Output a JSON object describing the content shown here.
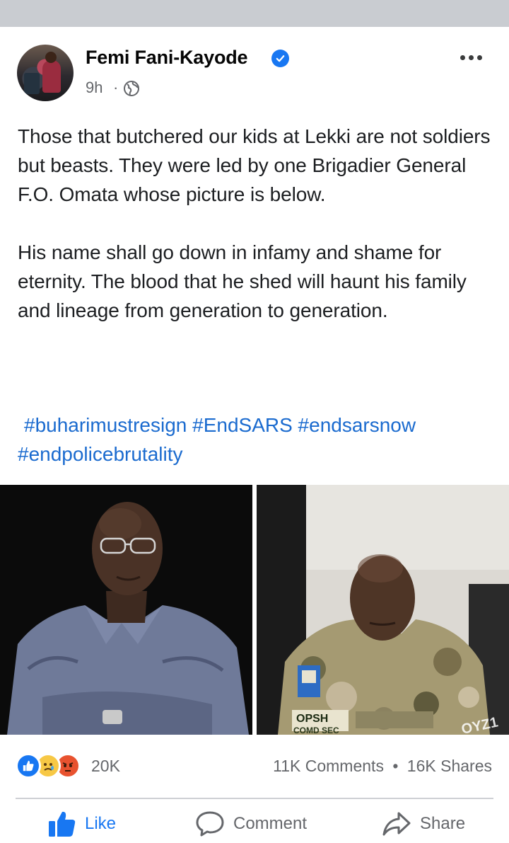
{
  "post": {
    "author": "Femi Fani-Kayode",
    "time": "9h",
    "separator": "·",
    "paragraphs": [
      "Those that butchered our kids at Lekki are not soldiers but beasts. They were led by one Brigadier General F.O. Omata whose picture is below.",
      "His name shall go down in infamy and shame for eternity. The blood that he shed will haunt his family and lineage from generation to generation."
    ],
    "hashtags": [
      "#buharimustresign",
      "#EndSARS",
      "#endsarsnow",
      "#endpolicebrutality"
    ],
    "photo_overlay_text": {
      "badge": "OPSH",
      "badge_sub": "COMD SEC",
      "watermark": "OYZ1"
    }
  },
  "stats": {
    "reactions_count": "20K",
    "comments": "11K Comments",
    "shares": "16K Shares",
    "bullet": "•"
  },
  "actions": {
    "like": "Like",
    "comment": "Comment",
    "share": "Share"
  },
  "colors": {
    "link_blue": "#1b6bcf",
    "fb_blue": "#1877f2",
    "muted": "#65676b"
  },
  "icons": [
    "verified-icon",
    "globe-icon",
    "more-icon",
    "like-reaction-icon",
    "sad-reaction-icon",
    "angry-reaction-icon",
    "thumbs-up-icon",
    "comment-icon",
    "share-icon"
  ]
}
